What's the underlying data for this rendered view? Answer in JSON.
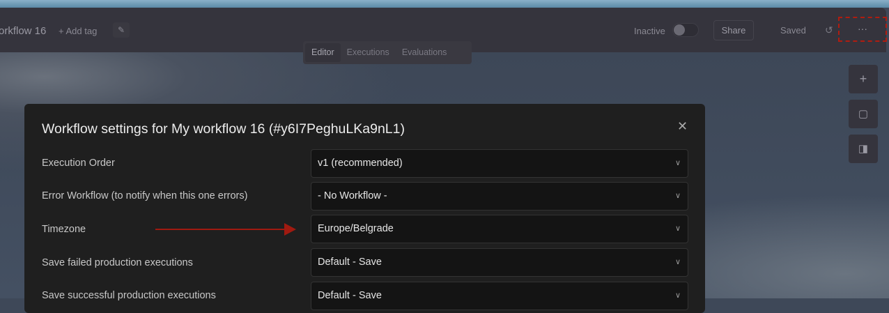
{
  "header": {
    "title": "orkflow 16",
    "add_tag": "+ Add tag",
    "status": "Inactive",
    "share": "Share",
    "saved": "Saved",
    "more": "···"
  },
  "tabs": [
    "Editor",
    "Executions",
    "Evaluations"
  ],
  "modal": {
    "title": "Workflow settings for My workflow 16 (#y6I7PeghuLKa9nL1)",
    "rows": [
      {
        "label": "Execution Order",
        "value": "v1 (recommended)"
      },
      {
        "label": "Error Workflow (to notify when this one errors)",
        "value": "- No Workflow -"
      },
      {
        "label": "Timezone",
        "value": "Europe/Belgrade"
      },
      {
        "label": "Save failed production executions",
        "value": "Default - Save"
      },
      {
        "label": "Save successful production executions",
        "value": "Default - Save"
      }
    ]
  },
  "colors": {
    "annotation": "#b01c10"
  }
}
